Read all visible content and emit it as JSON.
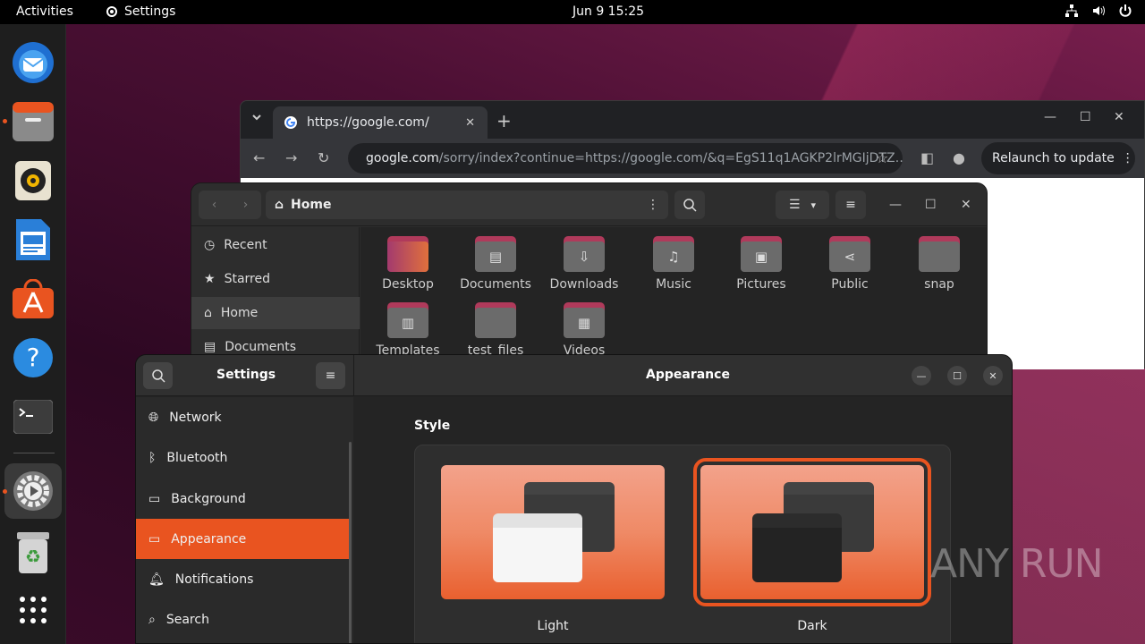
{
  "topbar": {
    "activities": "Activities",
    "app_menu": "Settings",
    "clock": "Jun 9  15:25",
    "tray_icons": [
      "network-icon",
      "volume-icon",
      "power-icon"
    ]
  },
  "dock": {
    "items": [
      "thunderbird",
      "files",
      "rhythmbox",
      "libreoffice-writer",
      "app-center",
      "help",
      "terminal",
      "settings",
      "trash",
      "show-apps"
    ]
  },
  "chrome": {
    "tab_title": "https://google.com/",
    "url_host": "google.com",
    "url_path": "/sorry/index?continue=https://google.com/&q=EgS11q1AGKP2lrMGIjDTZ…",
    "relaunch": "Relaunch to update"
  },
  "files": {
    "location": "Home",
    "sidebar": [
      "Recent",
      "Starred",
      "Home",
      "Documents"
    ],
    "folders": [
      "Desktop",
      "Documents",
      "Downloads",
      "Music",
      "Pictures",
      "Public",
      "snap",
      "Templates",
      "test_files",
      "Videos"
    ]
  },
  "settings": {
    "sidebar_title": "Settings",
    "page_title": "Appearance",
    "items": [
      "Network",
      "Bluetooth",
      "Background",
      "Appearance",
      "Notifications",
      "Search"
    ],
    "style_label": "Style",
    "light_label": "Light",
    "dark_label": "Dark"
  },
  "watermark": "ANY RUN",
  "colors": {
    "accent": "#e95420",
    "topbar": "#000000",
    "dock": "#1e1e1e"
  }
}
